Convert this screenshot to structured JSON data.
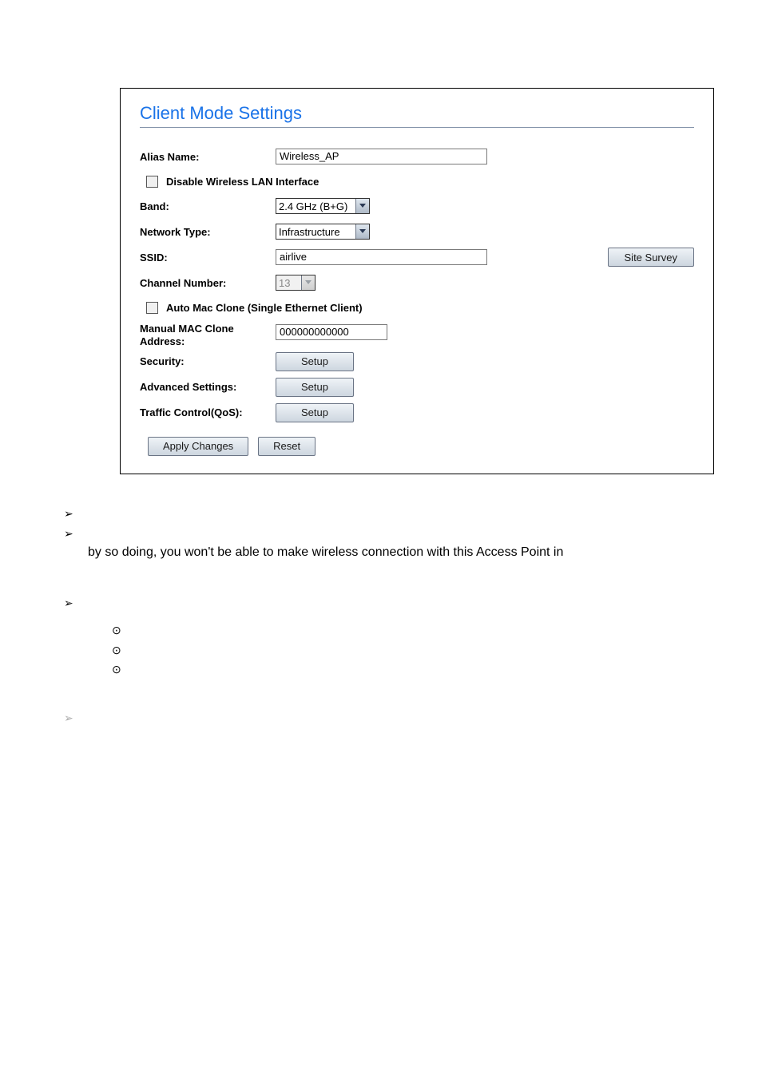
{
  "panel": {
    "title": "Client Mode Settings",
    "alias_label": "Alias Name:",
    "alias_value": "Wireless_AP",
    "disable_label": "Disable Wireless LAN Interface",
    "band_label": "Band:",
    "band_value": "2.4 GHz (B+G)",
    "nettype_label": "Network Type:",
    "nettype_value": "Infrastructure",
    "ssid_label": "SSID:",
    "ssid_value": "airlive",
    "site_survey": "Site Survey",
    "channel_label": "Channel Number:",
    "channel_value": "13",
    "automac_label": "Auto Mac Clone (Single Ethernet Client)",
    "manualmac_label": "Manual MAC Clone Address:",
    "manualmac_value": "000000000000",
    "security_label": "Security:",
    "adv_label": "Advanced Settings:",
    "qos_label": "Traffic Control(QoS):",
    "setup_btn": "Setup",
    "apply_btn": "Apply Changes",
    "reset_btn": "Reset"
  },
  "doc": {
    "line1": "by so doing, you won't be able to make wireless connection with this Access Point in"
  }
}
